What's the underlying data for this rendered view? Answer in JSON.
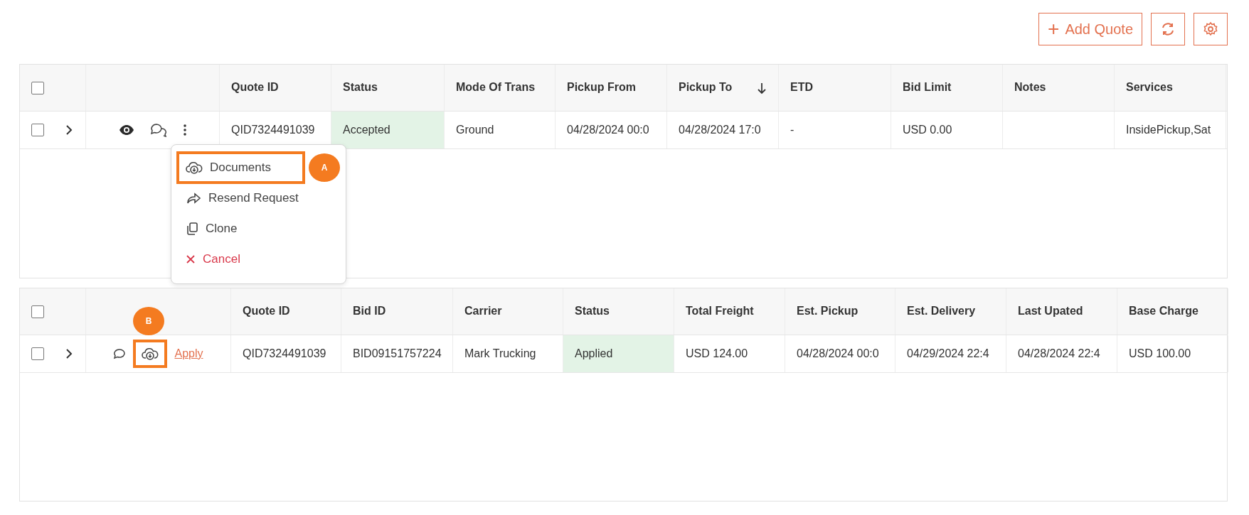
{
  "toolbar": {
    "add_button": {
      "icon": "+",
      "label": "Add Quote"
    }
  },
  "quotes_table": {
    "header_checkbox": {
      "checked": false
    },
    "columns": [
      {
        "label": "Quote ID",
        "sorted": false
      },
      {
        "label": "Status",
        "sorted": false
      },
      {
        "label": "Mode Of Trans",
        "sorted": false
      },
      {
        "label": "Pickup From",
        "sorted": false
      },
      {
        "label": "Pickup To",
        "sorted": true
      },
      {
        "label": "ETD",
        "sorted": false
      },
      {
        "label": "Bid Limit",
        "sorted": false
      },
      {
        "label": "Notes",
        "sorted": false
      },
      {
        "label": "Services",
        "sorted": false
      }
    ],
    "rows": [
      {
        "checked": false,
        "expanded": false,
        "cells": [
          "QID7324491039",
          "Accepted",
          "Ground",
          "04/28/2024 00:0",
          "04/28/2024 17:0",
          "-",
          "USD 0.00",
          "",
          "InsidePickup,Sat"
        ]
      }
    ]
  },
  "row_menu": {
    "items": [
      {
        "label": "Documents",
        "kind": "normal",
        "highlighted": true,
        "marker": "A"
      },
      {
        "label": "Resend Request",
        "kind": "normal",
        "highlighted": false
      },
      {
        "label": "Clone",
        "kind": "normal",
        "highlighted": false
      },
      {
        "label": "Cancel",
        "kind": "danger",
        "highlighted": false
      }
    ]
  },
  "bids_table": {
    "header_checkbox": {
      "checked": false
    },
    "columns": [
      {
        "label": "Quote ID"
      },
      {
        "label": "Bid ID"
      },
      {
        "label": "Carrier"
      },
      {
        "label": "Status"
      },
      {
        "label": "Total Freight"
      },
      {
        "label": "Est. Pickup"
      },
      {
        "label": "Est. Delivery"
      },
      {
        "label": "Last Upated"
      },
      {
        "label": "Base Charge"
      }
    ],
    "rows": [
      {
        "checked": false,
        "expanded": false,
        "apply_link": "Apply",
        "download_highlighted": true,
        "marker": "B",
        "cells": [
          "QID7324491039",
          "BID09151757224",
          "Mark Trucking",
          "Applied",
          "USD 124.00",
          "04/28/2024 00:0",
          "04/29/2024 22:4",
          "04/28/2024 22:4",
          "USD 100.00"
        ]
      }
    ]
  }
}
